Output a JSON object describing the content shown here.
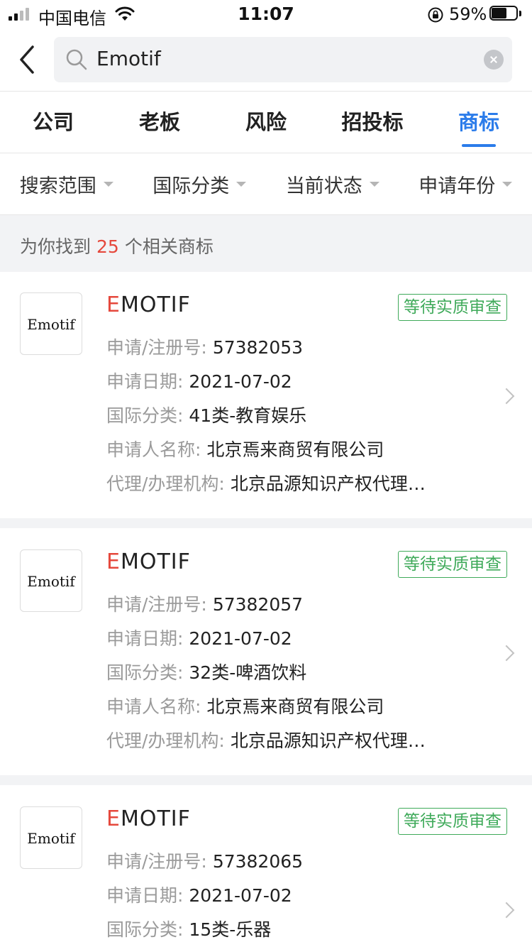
{
  "status_bar": {
    "carrier": "中国电信",
    "time": "11:07",
    "battery": "59%"
  },
  "search": {
    "query": "Emotif"
  },
  "tabs": [
    {
      "label": "公司"
    },
    {
      "label": "老板"
    },
    {
      "label": "风险"
    },
    {
      "label": "招投标"
    },
    {
      "label": "商标",
      "active": true
    }
  ],
  "filters": [
    {
      "label": "搜索范围"
    },
    {
      "label": "国际分类"
    },
    {
      "label": "当前状态"
    },
    {
      "label": "申请年份"
    }
  ],
  "result_summary": {
    "prefix": "为你找到",
    "count": "25",
    "suffix": "个相关商标"
  },
  "labels": {
    "reg_no": "申请/注册号:",
    "apply_date": "申请日期:",
    "class": "国际分类:",
    "applicant": "申请人名称:",
    "agent": "代理/办理机构:"
  },
  "results": [
    {
      "logo_text": "Emotif",
      "name_first": "E",
      "name_rest": "MOTIF",
      "status": "等待实质审查",
      "reg_no": "57382053",
      "apply_date": "2021-07-02",
      "class": "41类-教育娱乐",
      "applicant": "北京焉来商贸有限公司",
      "agent": "北京品源知识产权代理…"
    },
    {
      "logo_text": "Emotif",
      "name_first": "E",
      "name_rest": "MOTIF",
      "status": "等待实质审查",
      "reg_no": "57382057",
      "apply_date": "2021-07-02",
      "class": "32类-啤酒饮料",
      "applicant": "北京焉来商贸有限公司",
      "agent": "北京品源知识产权代理…"
    },
    {
      "logo_text": "Emotif",
      "name_first": "E",
      "name_rest": "MOTIF",
      "status": "等待实质审查",
      "reg_no": "57382065",
      "apply_date": "2021-07-02",
      "class": "15类-乐器"
    }
  ]
}
